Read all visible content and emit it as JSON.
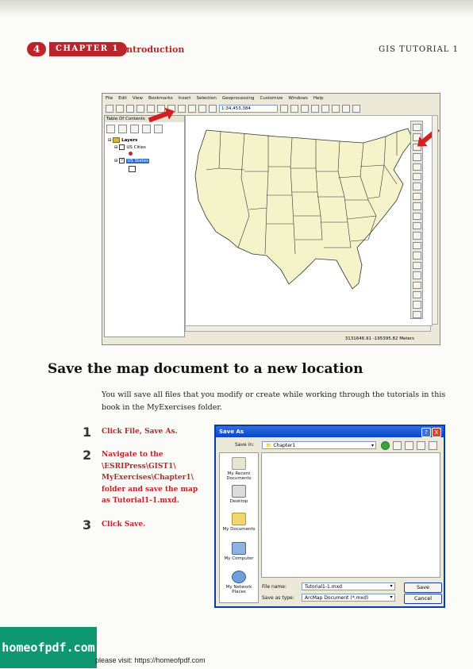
{
  "header": {
    "page_number": "4",
    "chapter": "CHAPTER 1",
    "section": "Introduction",
    "running_head": "GIS TUTORIAL 1"
  },
  "arcmap": {
    "menu": [
      "File",
      "Edit",
      "View",
      "Bookmarks",
      "Insert",
      "Selection",
      "Geoprocessing",
      "Customize",
      "Windows",
      "Help"
    ],
    "scale": "1:34,453,384",
    "toc_title": "Table Of Contents",
    "toc_pin": "3 X",
    "layers_label": "Layers",
    "layer_cities": "US Cities",
    "layer_states": "US States",
    "status_coords": "3131646.91  -195395.82 Meters"
  },
  "section_heading": "Save the map document to a new location",
  "intro_paragraph": "You will save all files that you modify or create while working through the tutorials in this book in the MyExercises folder.",
  "steps": [
    {
      "number": "1",
      "text": "Click File, Save As."
    },
    {
      "number": "2",
      "text": "Navigate to the \\ESRIPress\\GIST1\\ MyExercises\\Chapter1\\ folder and save the map as Tutorial1-1.mxd."
    },
    {
      "number": "3",
      "text": "Click Save."
    }
  ],
  "dialog": {
    "title": "Save As",
    "save_in_label": "Save in:",
    "save_in_value": "Chapter1",
    "places": [
      "My Recent Documents",
      "Desktop",
      "My Documents",
      "My Computer",
      "My Network Places"
    ],
    "file_name_label": "File name:",
    "file_name_value": "Tutorial1-1.mxd",
    "save_type_label": "Save as type:",
    "save_type_value": "ArcMap Document (*.mxd)",
    "save_button": "Save",
    "cancel_button": "Cancel",
    "help_button": "?",
    "close_button": "X"
  },
  "footer": {
    "logo_text": "homeofpdf.com",
    "visit_text": "please visit: https://homeofpdf.com"
  }
}
